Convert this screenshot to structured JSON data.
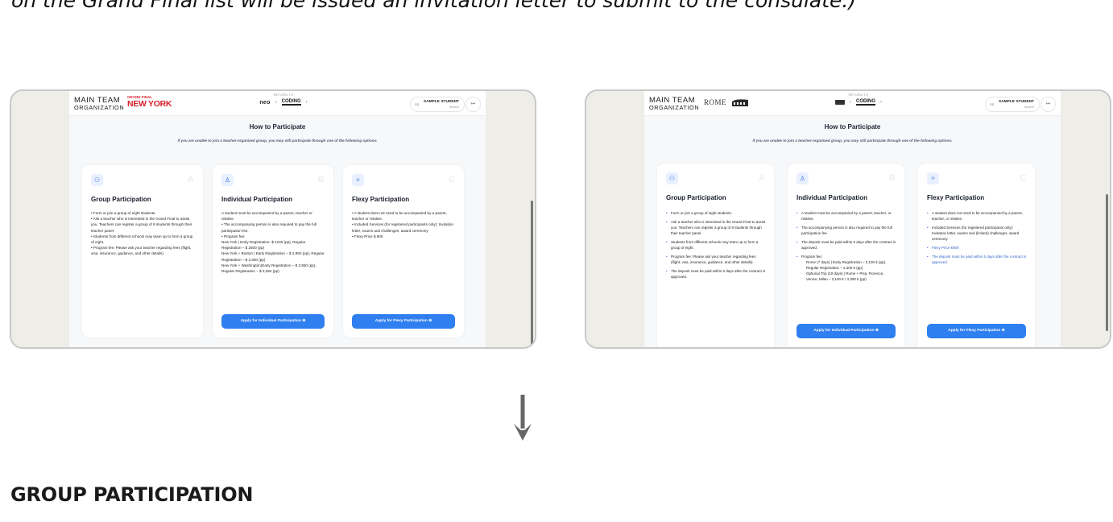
{
  "caption": "on the Grand Final list will be issued an invitation letter to submit to the consulate.)",
  "section_title": "GROUP PARTICIPATION",
  "down_arrow_icon": "arrow-down-icon",
  "colors": {
    "accent": "#2f7ff0",
    "brand_red": "#d8202a",
    "icon_bg": "#e9f0ff",
    "frame_bg": "#eeede7"
  },
  "left": {
    "logo_line1": "MAIN TEAM",
    "logo_line2": "ORGANIZATION",
    "grand_final_small": "GRAND FINAL",
    "grand_final_city": "NEW YORK",
    "return_to": "RETURN TO",
    "neo": "neo",
    "coding": "CODING",
    "user_name": "SAMPLE STUDENT",
    "user_role": "Student",
    "user_initials": "SS",
    "title": "How to Participate",
    "subtitle": "If you are unable to join a teacher-organized group, you may still participate through one of the following options:",
    "cards": [
      {
        "letter": "A",
        "title": "Group Participation",
        "lines": [
          "• Form or join a group of eight students.",
          "• Ask a teacher who is interested in the Grand Final to assist you. Teachers can register a group of 8 students through their teacher panel.",
          "• Students from different schools may team up to form a group of eight.",
          "• Program fee: Please ask your teacher regarding fees (flight, visa, insurance, guidance, and other details)."
        ]
      },
      {
        "letter": "B",
        "title": "Individual Participation",
        "lines": [
          "A student must be accompanied by a parent, teacher or relative.",
          "• The accompanying person is also required to pay the full participation fee.",
          "• Program fee:",
          "New York | Early Registration- $ 2100 (pp), Regular Registration – $ 2500 (pp)",
          "New York + Boston | Early Registration – $ 2,950 (pp), Regular Registration – $ 3,350 (pp)",
          "New York + Washington(Early Registration – $ 2,950 (pp), Regular Registration – $ 3,350 (pp)"
        ],
        "button": "Apply for Individual Participation"
      },
      {
        "letter": "C",
        "title": "Flexy Participation",
        "lines": [
          "• A student does not need to be accompanied by a parent, teacher or relative.",
          "• Included Services (for registered participants only): Invitation letter, exams and challenges, award ceremony",
          "• Flexy Price $ 800"
        ],
        "button": "Apply for Flexy Participation"
      }
    ]
  },
  "right": {
    "logo_line1": "MAIN TEAM",
    "logo_line2": "ORGANIZATION",
    "city_logo": "ROME",
    "return_to": "RETURN TO",
    "coding": "CODING",
    "user_name": "SAMPLE STUDENT",
    "user_role": "Student",
    "user_initials": "SS",
    "title": "How to Participate",
    "subtitle": "If you are unable to join a teacher-organized group, you may still participate through one of the following options:",
    "cards": [
      {
        "letter": "A",
        "title": "Group Participation",
        "items": [
          "Form or join a group of eight students.",
          "Ask a teacher who is interested in the Grand Final to assist you. Teachers can register a group of 8 students through their teacher panel.",
          "Students from different schools may team up to form a group of eight.",
          "Program fee: Please ask your teacher regarding fees (flight, visa, insurance, guidance, and other details).",
          "The deposit must be paid within 5 days after the contract is approved."
        ]
      },
      {
        "letter": "B",
        "title": "Individual Participation",
        "items": [
          "A student must be accompanied by a parent, teacher, or relative.",
          "The accompanying person is also required to pay the full participation fee.",
          "The deposit must be paid within 5 days after the contract is approved.",
          "Program fee:"
        ],
        "fee_lines": [
          "Rome (7 days) | Early Registration – 2,100 € (pp), Regular Registration – 2,300 € (pp)",
          "Optional Trip (10 days) | Rome + Pisa, Florence, Venice, Milan – 3,100 € / 3,300 € (pp)"
        ],
        "button": "Apply for Individual Participation"
      },
      {
        "letter": "C",
        "title": "Flexy Participation",
        "items": [
          "A student does not need to be accompanied by a parent, teacher, or relative.",
          "Included Services (for registered participants only): Invitation letter, exams and (limited) challenges, award ceremony"
        ],
        "blue_items": [
          "Flexy Price €900",
          "The deposit must be paid within 5 days after the contract is approved."
        ],
        "button": "Apply for Flexy Participation"
      }
    ]
  }
}
